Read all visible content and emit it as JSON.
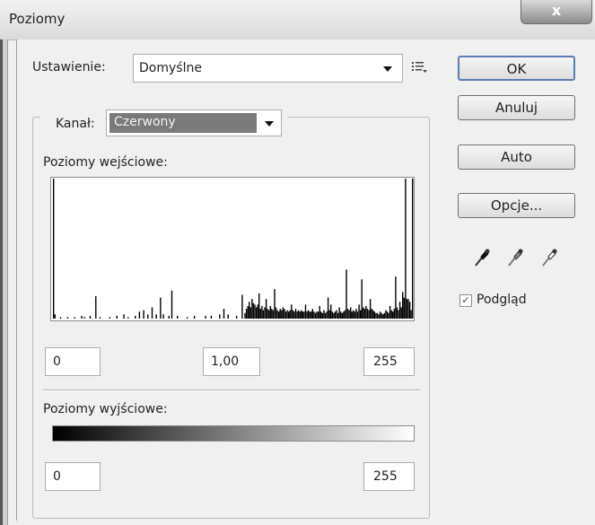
{
  "window": {
    "title": "Poziomy",
    "close_glyph": "x"
  },
  "preset": {
    "label": "Ustawienie:",
    "value": "Domyślne",
    "menu_icon": "preset-options-icon"
  },
  "channel": {
    "label": "Kanał:",
    "value": "Czerwony"
  },
  "input_levels": {
    "label": "Poziomy wejściowe:",
    "black": "0",
    "gamma": "1,00",
    "white": "255"
  },
  "output_levels": {
    "label": "Poziomy wyjściowe:",
    "black": "0",
    "white": "255"
  },
  "buttons": {
    "ok": "OK",
    "cancel": "Anuluj",
    "auto": "Auto",
    "options": "Opcje..."
  },
  "eyedroppers": [
    "black-point-eyedropper-icon",
    "gray-point-eyedropper-icon",
    "white-point-eyedropper-icon"
  ],
  "preview": {
    "label": "Podgląd",
    "checked": true
  },
  "chart_data": {
    "type": "bar",
    "x_range": [
      0,
      255
    ],
    "y_range": [
      0,
      1
    ],
    "bins": [
      [
        0,
        1.0
      ],
      [
        1,
        0.03
      ],
      [
        5,
        0.01
      ],
      [
        10,
        0.01
      ],
      [
        15,
        0.01
      ],
      [
        20,
        0.02
      ],
      [
        22,
        0.01
      ],
      [
        26,
        0.02
      ],
      [
        30,
        0.16
      ],
      [
        33,
        0.01
      ],
      [
        40,
        0.01
      ],
      [
        45,
        0.02
      ],
      [
        50,
        0.03
      ],
      [
        53,
        0.01
      ],
      [
        58,
        0.02
      ],
      [
        61,
        0.05
      ],
      [
        64,
        0.06
      ],
      [
        67,
        0.03
      ],
      [
        70,
        0.08
      ],
      [
        73,
        0.03
      ],
      [
        76,
        0.15
      ],
      [
        78,
        0.03
      ],
      [
        82,
        0.02
      ],
      [
        84,
        0.2
      ],
      [
        88,
        0.02
      ],
      [
        95,
        0.01
      ],
      [
        100,
        0.02
      ],
      [
        108,
        0.02
      ],
      [
        112,
        0.02
      ],
      [
        118,
        0.03
      ],
      [
        121,
        0.07
      ],
      [
        124,
        0.03
      ],
      [
        130,
        0.02
      ],
      [
        134,
        0.17
      ],
      [
        136,
        0.04
      ],
      [
        137,
        0.07
      ],
      [
        138,
        0.09
      ],
      [
        139,
        0.12
      ],
      [
        140,
        0.08
      ],
      [
        141,
        0.14
      ],
      [
        142,
        0.11
      ],
      [
        143,
        0.1
      ],
      [
        144,
        0.08
      ],
      [
        145,
        0.1
      ],
      [
        146,
        0.18
      ],
      [
        147,
        0.07
      ],
      [
        148,
        0.09
      ],
      [
        149,
        0.06
      ],
      [
        150,
        0.08
      ],
      [
        151,
        0.14
      ],
      [
        152,
        0.07
      ],
      [
        153,
        0.06
      ],
      [
        154,
        0.09
      ],
      [
        155,
        0.07
      ],
      [
        156,
        0.06
      ],
      [
        157,
        0.21
      ],
      [
        158,
        0.08
      ],
      [
        159,
        0.06
      ],
      [
        160,
        0.05
      ],
      [
        161,
        0.07
      ],
      [
        162,
        0.06
      ],
      [
        163,
        0.08
      ],
      [
        164,
        0.07
      ],
      [
        165,
        0.05
      ],
      [
        166,
        0.06
      ],
      [
        167,
        0.05
      ],
      [
        168,
        0.06
      ],
      [
        169,
        0.1
      ],
      [
        170,
        0.06
      ],
      [
        171,
        0.05
      ],
      [
        172,
        0.07
      ],
      [
        173,
        0.05
      ],
      [
        174,
        0.06
      ],
      [
        175,
        0.05
      ],
      [
        176,
        0.06
      ],
      [
        177,
        0.05
      ],
      [
        178,
        0.05
      ],
      [
        179,
        0.1
      ],
      [
        180,
        0.05
      ],
      [
        181,
        0.06
      ],
      [
        182,
        0.05
      ],
      [
        183,
        0.05
      ],
      [
        184,
        0.07
      ],
      [
        185,
        0.05
      ],
      [
        186,
        0.04
      ],
      [
        187,
        0.05
      ],
      [
        188,
        0.05
      ],
      [
        189,
        0.09
      ],
      [
        190,
        0.05
      ],
      [
        191,
        0.04
      ],
      [
        192,
        0.06
      ],
      [
        193,
        0.04
      ],
      [
        194,
        0.05
      ],
      [
        195,
        0.15
      ],
      [
        196,
        0.06
      ],
      [
        197,
        0.1
      ],
      [
        198,
        0.05
      ],
      [
        199,
        0.04
      ],
      [
        200,
        0.05
      ],
      [
        201,
        0.06
      ],
      [
        202,
        0.04
      ],
      [
        203,
        0.08
      ],
      [
        204,
        0.05
      ],
      [
        205,
        0.04
      ],
      [
        206,
        0.05
      ],
      [
        207,
        0.06
      ],
      [
        208,
        0.35
      ],
      [
        209,
        0.07
      ],
      [
        210,
        0.06
      ],
      [
        211,
        0.08
      ],
      [
        212,
        0.05
      ],
      [
        213,
        0.06
      ],
      [
        214,
        0.05
      ],
      [
        215,
        0.07
      ],
      [
        216,
        0.05
      ],
      [
        217,
        0.1
      ],
      [
        218,
        0.06
      ],
      [
        219,
        0.28
      ],
      [
        220,
        0.08
      ],
      [
        221,
        0.07
      ],
      [
        222,
        0.09
      ],
      [
        223,
        0.07
      ],
      [
        224,
        0.06
      ],
      [
        225,
        0.14
      ],
      [
        226,
        0.07
      ],
      [
        227,
        0.06
      ],
      [
        228,
        0.05
      ],
      [
        229,
        0.04
      ],
      [
        230,
        0.04
      ],
      [
        231,
        0.03
      ],
      [
        232,
        0.05
      ],
      [
        233,
        0.04
      ],
      [
        234,
        0.03
      ],
      [
        235,
        0.04
      ],
      [
        236,
        0.06
      ],
      [
        237,
        0.05
      ],
      [
        238,
        0.04
      ],
      [
        239,
        0.09
      ],
      [
        240,
        0.06
      ],
      [
        241,
        0.05
      ],
      [
        242,
        0.07
      ],
      [
        243,
        0.3
      ],
      [
        244,
        0.08
      ],
      [
        245,
        0.06
      ],
      [
        246,
        0.12
      ],
      [
        247,
        0.08
      ],
      [
        248,
        0.19
      ],
      [
        249,
        0.15
      ],
      [
        250,
        1.0
      ],
      [
        251,
        0.14
      ],
      [
        252,
        0.14
      ],
      [
        253,
        0.12
      ],
      [
        254,
        0.06
      ],
      [
        255,
        1.0
      ]
    ]
  }
}
